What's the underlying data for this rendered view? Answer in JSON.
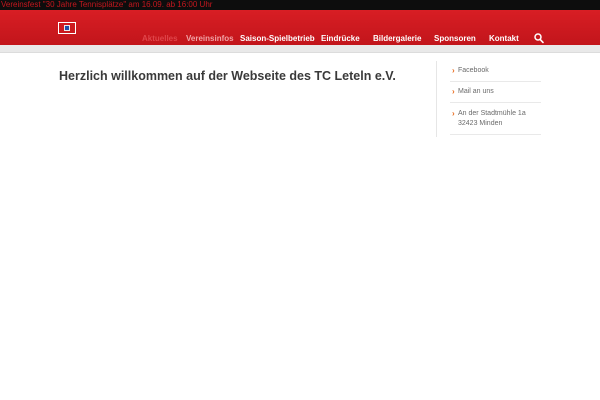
{
  "announcement": "Vereinsfest \"30 Jahre Tennisplätze\" am 16.09. ab 16:00 Uhr",
  "header": {
    "logo_icon": "club-logo-icon",
    "nav": [
      {
        "label": "Aktuelles"
      },
      {
        "label": "Vereinsinfos"
      },
      {
        "label": "Saison-Spielbetrieb"
      },
      {
        "label": "Eindrücke"
      },
      {
        "label": "Bildergalerie"
      },
      {
        "label": "Sponsoren"
      },
      {
        "label": "Kontakt"
      }
    ],
    "search_icon": "search-icon"
  },
  "main": {
    "title": "Herzlich willkommen auf der Webseite des TC Leteln e.V."
  },
  "sidebar": {
    "links": [
      {
        "label": "Facebook"
      },
      {
        "label": "Mail an uns"
      }
    ],
    "address": {
      "street": "An der Stadtmühle 1a",
      "city": "32423 Minden"
    }
  },
  "colors": {
    "brand_red": "#d81e24",
    "top_bar": "#0d0d0d",
    "accent_orange": "#e86a1c"
  }
}
